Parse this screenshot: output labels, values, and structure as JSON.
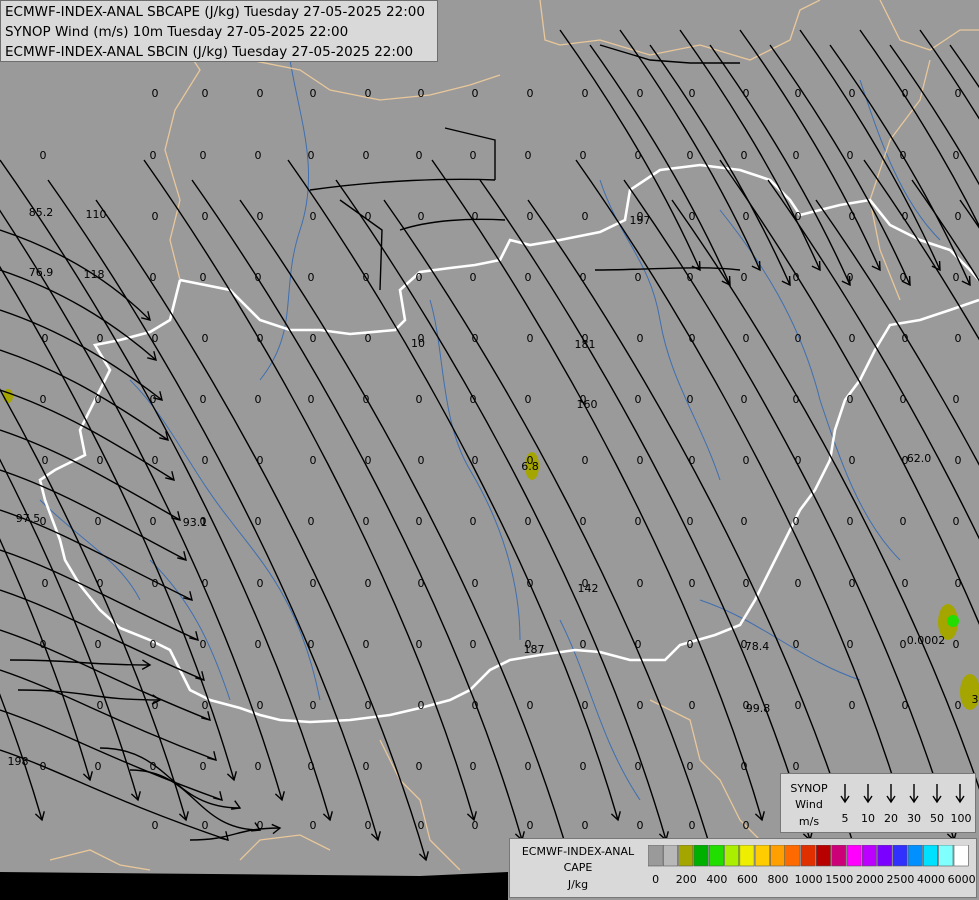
{
  "titles": [
    "ECMWF-INDEX-ANAL SBCAPE (J/kg) Tuesday 27-05-2025 22:00",
    "SYNOP Wind (m/s) 10m Tuesday 27-05-2025 22:00",
    "ECMWF-INDEX-ANAL SBCIN (J/kg) Tuesday 27-05-2025 22:00"
  ],
  "colors": {
    "background": "#9a9a9a",
    "border_national": "#ffffff",
    "border_other": "#e8c79a",
    "rivers": "#3f6fb0",
    "streamlines": "#000000"
  },
  "value_labels": [
    {
      "text": "0",
      "grid": "r0c8"
    },
    {
      "text": "0",
      "grid": "r0c9"
    },
    {
      "text": "0",
      "grid": "r0c10"
    },
    {
      "text": "85.2",
      "grid": "a"
    },
    {
      "text": "110",
      "grid": "b"
    },
    {
      "text": "76.9",
      "grid": "c"
    },
    {
      "text": "118",
      "grid": "d"
    },
    {
      "text": "197",
      "grid": "e"
    },
    {
      "text": "181",
      "grid": "f"
    },
    {
      "text": "160",
      "grid": "g"
    },
    {
      "text": "6.8",
      "grid": "h"
    },
    {
      "text": "62.0",
      "grid": "i"
    },
    {
      "text": "97.5",
      "grid": "j"
    },
    {
      "text": "93.1",
      "grid": "k"
    },
    {
      "text": "142",
      "grid": "l"
    },
    {
      "text": "0.0002",
      "grid": "m"
    },
    {
      "text": "78.4",
      "grid": "n"
    },
    {
      "text": "187",
      "grid": "o"
    },
    {
      "text": "99.8",
      "grid": "p"
    },
    {
      "text": "198",
      "grid": "q"
    },
    {
      "text": "10",
      "grid": "r"
    },
    {
      "text": "3",
      "grid": "s"
    }
  ],
  "wind_legend": {
    "title_line1": "SYNOP",
    "title_line2": "Wind",
    "unit": "m/s",
    "speeds": [
      "5",
      "10",
      "20",
      "30",
      "50",
      "100"
    ]
  },
  "cape_legend": {
    "title_line1": "ECMWF-INDEX-ANAL",
    "title_line2": "CAPE",
    "unit": "J/kg",
    "ticks": [
      "0",
      "200",
      "400",
      "600",
      "800",
      "1000",
      "1500",
      "2000",
      "2500",
      "4000",
      "6000"
    ],
    "colors": [
      "#9a9a9a",
      "#b8b8b8",
      "#a5a500",
      "#00b000",
      "#22dd00",
      "#aaee00",
      "#eeee00",
      "#ffcc00",
      "#ffa000",
      "#ff6a00",
      "#e03000",
      "#b80000",
      "#cc0077",
      "#ff00ff",
      "#bb00ff",
      "#7a00ff",
      "#3030ff",
      "#0090ff",
      "#00e0ff",
      "#80ffff",
      "#ffffff"
    ]
  }
}
